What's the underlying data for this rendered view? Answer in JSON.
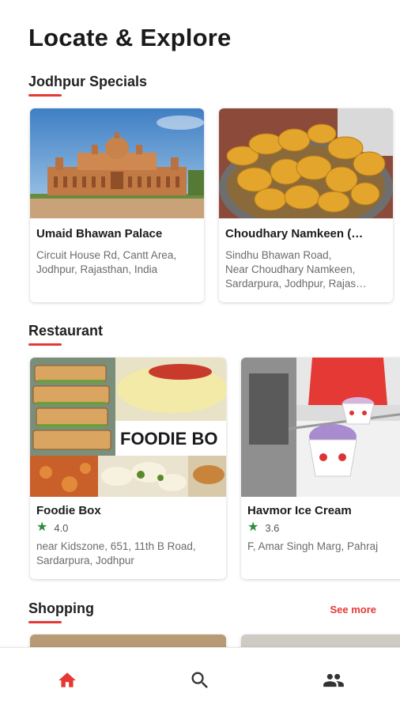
{
  "header": {
    "title": "Locate & Explore"
  },
  "sections": {
    "specials": {
      "heading": "Jodhpur Specials",
      "cards": [
        {
          "title": "Umaid Bhawan Palace",
          "address": "Circuit House Rd, Cantt Area, Jodhpur, Rajasthan, India"
        },
        {
          "title": "Choudhary Namkeen (…",
          "address_lines": [
            "Sindhu Bhawan Road,",
            "Near Choudhary Namkeen,",
            "Sardarpura, Jodhpur, Rajas…"
          ]
        }
      ]
    },
    "restaurant": {
      "heading": "Restaurant",
      "cards": [
        {
          "title": "Foodie Box",
          "rating": "4.0",
          "address": "near Kidszone, 651, 11th B Road, Sardarpura, Jodhpur",
          "image_text": "FOODIE BO"
        },
        {
          "title": "Havmor Ice Cream",
          "rating": "3.6",
          "address": "F, Amar Singh Marg, Pahraj"
        }
      ]
    },
    "shopping": {
      "heading": "Shopping",
      "see_more": "See more"
    }
  },
  "bottom_nav": {
    "items": [
      {
        "icon": "home-icon",
        "active": true
      },
      {
        "icon": "search-icon",
        "active": false
      },
      {
        "icon": "people-icon",
        "active": false
      }
    ],
    "active_color": "#e53935",
    "inactive_color": "#333333"
  },
  "colors": {
    "accent": "#e53935",
    "rating_star": "#2e8b3a"
  }
}
